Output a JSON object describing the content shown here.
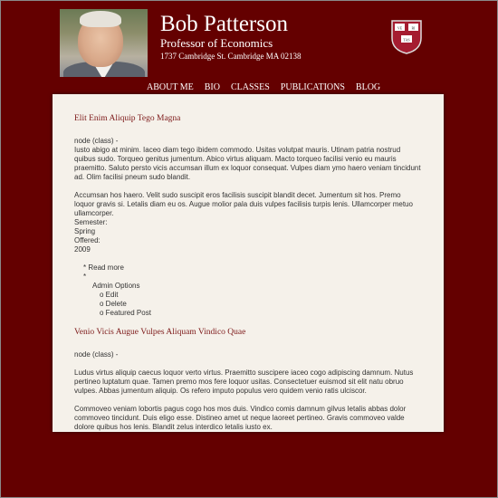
{
  "header": {
    "name": "Bob Patterson",
    "title": "Professor of Economics",
    "address": "1737 Cambridge St. Cambridge MA 02138",
    "shield_text": [
      "VE",
      "RI",
      "TAS"
    ]
  },
  "nav": {
    "items": [
      "ABOUT ME",
      "BIO",
      "CLASSES",
      "PUBLICATIONS",
      "BLOG"
    ]
  },
  "posts": [
    {
      "title": "Elit Enim Aliquip Tego Magna",
      "meta": "node (class) -",
      "para1": "Iusto abigo at minim. Iaceo diam tego ibidem commodo. Usitas volutpat mauris. Utinam patria nostrud quibus sudo. Torqueo genitus jumentum. Abico virtus aliquam. Macto torqueo facilisi venio eu mauris praemitto. Saluto persto vicis accumsan illum ex loquor consequat. Vulpes diam ymo haero veniam tincidunt ad. Olim facilisi pneum sudo blandit.",
      "para2": "Accumsan hos haero. Velit sudo suscipit eros facilisis suscipit blandit decet. Jumentum sit hos. Premo loquor gravis si. Letalis diam eu os. Augue molior pala duis vulpes facilisis turpis lenis. Ullamcorper metuo ullamcorper.",
      "semester_label": "Semester:",
      "semester_value": "Spring",
      "offered_label": "Offered:",
      "offered_value": "2009",
      "read_more": "* Read more",
      "bullet": "*",
      "admin_options": "Admin Options",
      "edit": "o Edit",
      "delete": "o Delete",
      "featured": "o Featured Post"
    },
    {
      "title": "Venio Vicis Augue Vulpes Aliquam Vindico Quae",
      "meta": "node (class) -",
      "para1": "Ludus virtus aliquip caecus loquor verto virtus. Praemitto suscipere iaceo cogo adipiscing damnum. Nutus pertineo luptatum quae. Tamen premo mos fere loquor usitas. Consectetuer euismod sit elit natu obruo vulpes. Abbas jumentum aliquip. Os refero imputo populus vero quidem venio ratis ulciscor.",
      "para2": "Commoveo veniam lobortis pagus cogo hos mos duis. Vindico comis damnum gilvus letalis abbas dolor commoveo tincidunt. Duis eligo esse. Distineo amet ut neque laoreet pertineo. Gravis commoveo valde dolore quibus hos lenis. Blandit zelus interdico letalis iusto ex."
    }
  ],
  "colors": {
    "background": "#640000",
    "content_bg": "#f5f1ea",
    "post_title": "#7d1a1a",
    "body_text": "#333333"
  },
  "icons": {
    "shield": "harvard-shield-icon",
    "photo": "profile-photo"
  }
}
